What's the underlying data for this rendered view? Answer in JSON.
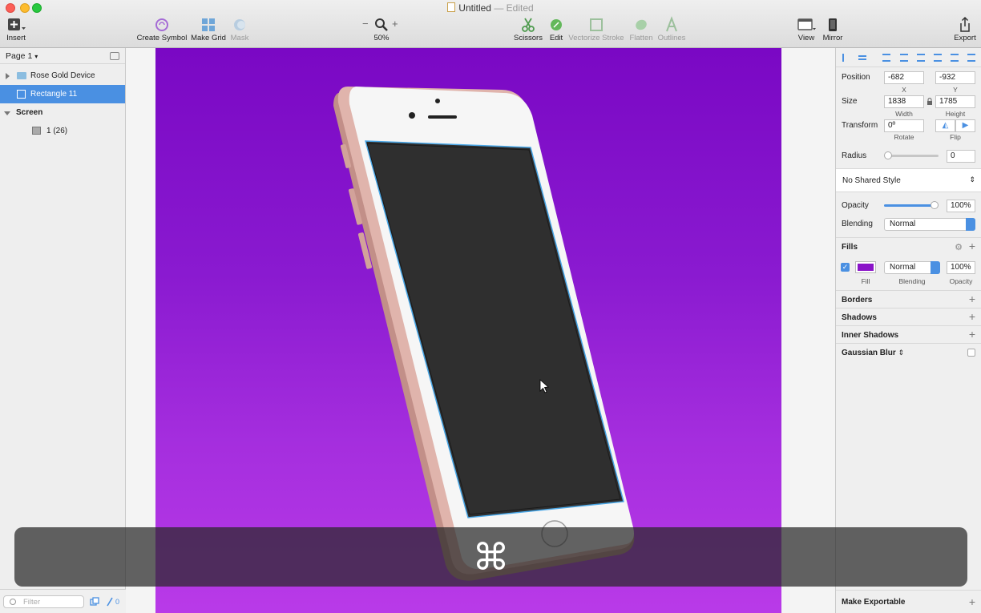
{
  "window": {
    "title": "Untitled",
    "separator": "—",
    "status": "Edited"
  },
  "toolbar": {
    "insert": "Insert",
    "create_symbol": "Create Symbol",
    "make_grid": "Make Grid",
    "mask": "Mask",
    "zoom_minus": "−",
    "zoom_plus": "+",
    "zoom_level": "50%",
    "scissors": "Scissors",
    "edit": "Edit",
    "vectorize_stroke": "Vectorize Stroke",
    "flatten": "Flatten",
    "outlines": "Outlines",
    "view": "View",
    "mirror": "Mirror",
    "export": "Export"
  },
  "sidebar": {
    "page": "Page 1",
    "layers": [
      {
        "label": "Rose Gold Device"
      },
      {
        "label": "Rectangle 11"
      },
      {
        "label": "Screen"
      },
      {
        "label": "1 (26)"
      }
    ],
    "filter_placeholder": "Filter",
    "slice_count": "0"
  },
  "inspector": {
    "position_label": "Position",
    "x_value": "-682",
    "y_value": "-932",
    "x_label": "X",
    "y_label": "Y",
    "size_label": "Size",
    "width_value": "1838",
    "height_value": "1785",
    "width_label": "Width",
    "height_label": "Height",
    "transform_label": "Transform",
    "rotate_value": "0º",
    "rotate_label": "Rotate",
    "flip_label": "Flip",
    "radius_label": "Radius",
    "radius_value": "0",
    "shared_style": "No Shared Style",
    "opacity_label": "Opacity",
    "opacity_value": "100%",
    "blending_label": "Blending",
    "blending_value": "Normal",
    "fills_label": "Fills",
    "fill_blending_value": "Normal",
    "fill_opacity_value": "100%",
    "fill_label": "Fill",
    "fill_blending_label": "Blending",
    "fill_opacity_label": "Opacity",
    "borders_label": "Borders",
    "shadows_label": "Shadows",
    "inner_shadows_label": "Inner Shadows",
    "gaussian_blur_label": "Gaussian Blur",
    "make_exportable": "Make Exportable"
  },
  "hud": {
    "glyph": "⌘"
  },
  "colors": {
    "accent": "#4a90e2",
    "fill_swatch": "#8a14c8",
    "artboard_top": "#7a08c4",
    "artboard_bottom": "#b93ae8"
  }
}
